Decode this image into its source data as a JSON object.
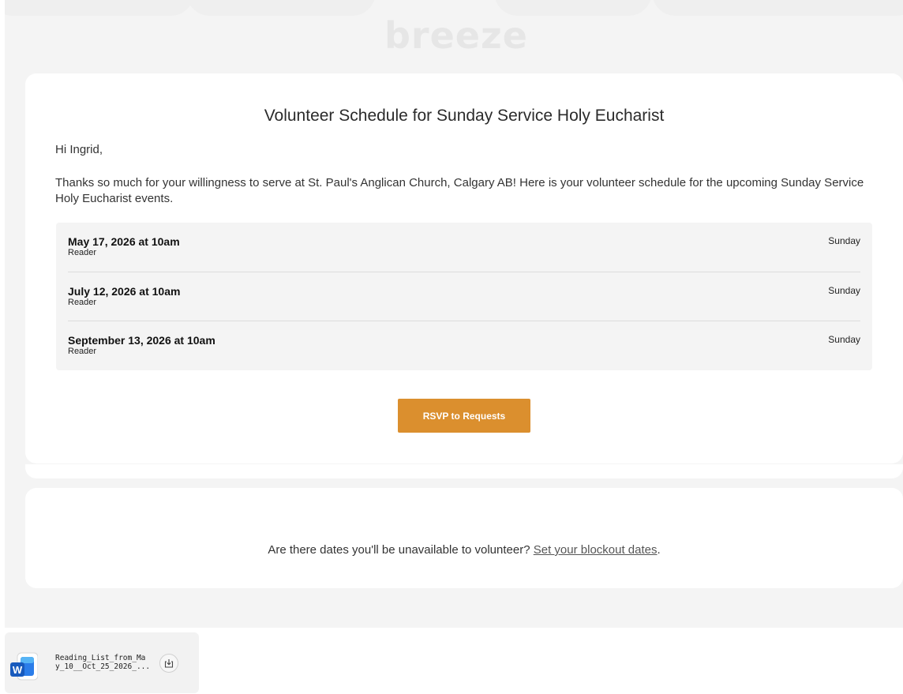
{
  "brand": {
    "logo_text": "breeze"
  },
  "email": {
    "title": "Volunteer Schedule for Sunday Service Holy Eucharist",
    "greeting": "Hi Ingrid,",
    "intro": "Thanks so much for your willingness to serve at St. Paul's Anglican Church, Calgary AB! Here is your volunteer schedule for the upcoming Sunday Service Holy Eucharist events.",
    "schedule": [
      {
        "date": "May 17, 2026 at 10am",
        "role": "Reader",
        "day": "Sunday"
      },
      {
        "date": "July 12, 2026 at 10am",
        "role": "Reader",
        "day": "Sunday"
      },
      {
        "date": "September 13, 2026 at 10am",
        "role": "Reader",
        "day": "Sunday"
      }
    ],
    "rsvp_label": "RSVP to Requests",
    "blockout_prompt": "Are there dates you'll be unavailable to volunteer?",
    "blockout_link": "Set your blockout dates",
    "blockout_suffix": "."
  },
  "download": {
    "filename_line1": "Reading_List_from_Ma",
    "filename_line2": "y_10__Oct_25_2026_...",
    "icon": "word-document-icon",
    "action_icon": "download-icon"
  },
  "colors": {
    "accent_button": "#db8f2e",
    "page_background": "#f4f4f4",
    "word_blue": "#185abd"
  }
}
